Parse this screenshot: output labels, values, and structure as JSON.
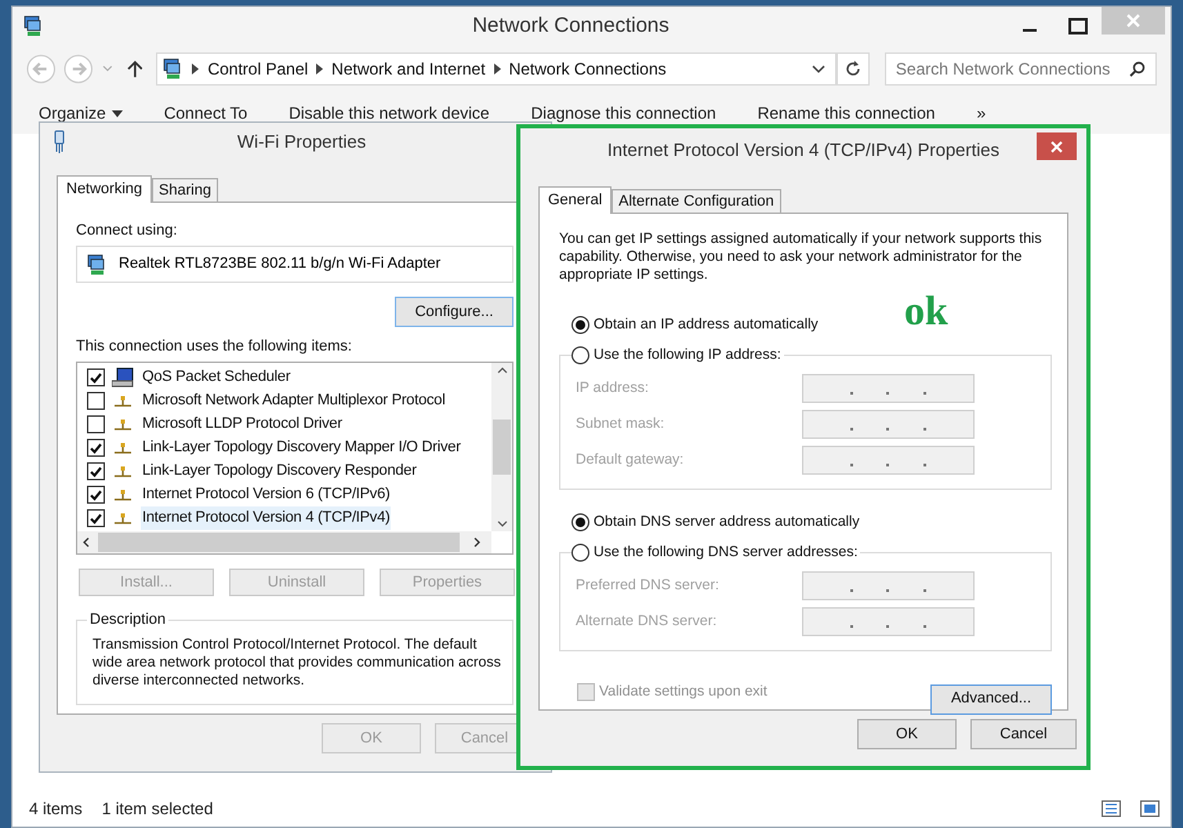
{
  "window": {
    "title": "Network Connections"
  },
  "address_bar": {
    "path": [
      "Control Panel",
      "Network and Internet",
      "Network Connections"
    ]
  },
  "search": {
    "placeholder": "Search Network Connections"
  },
  "toolbar": {
    "items": [
      {
        "label": "Organize",
        "kind": "menu"
      },
      {
        "label": "Connect To",
        "kind": "button"
      },
      {
        "label": "Disable this network device",
        "kind": "button"
      },
      {
        "label": "Diagnose this connection",
        "kind": "button"
      },
      {
        "label": "Rename this connection",
        "kind": "button"
      },
      {
        "label": "»",
        "kind": "button"
      }
    ]
  },
  "wifi_dialog": {
    "title": "Wi-Fi Properties",
    "tabs": [
      {
        "label": "Networking",
        "selected": true
      },
      {
        "label": "Sharing",
        "selected": false
      }
    ],
    "connect_using_label": "Connect using:",
    "adapter": "Realtek RTL8723BE 802.11 b/g/n Wi-Fi Adapter",
    "configure_button": "Configure...",
    "items_label": "This connection uses the following items:",
    "items": [
      {
        "label": "QoS Packet Scheduler",
        "kind": "service",
        "checked": true,
        "selected": false
      },
      {
        "label": "Microsoft Network Adapter Multiplexor Protocol",
        "kind": "protocol",
        "checked": false,
        "selected": false
      },
      {
        "label": "Microsoft LLDP Protocol Driver",
        "kind": "protocol",
        "checked": false,
        "selected": false
      },
      {
        "label": "Link-Layer Topology Discovery Mapper I/O Driver",
        "kind": "protocol",
        "checked": true,
        "selected": false
      },
      {
        "label": "Link-Layer Topology Discovery Responder",
        "kind": "protocol",
        "checked": true,
        "selected": false
      },
      {
        "label": "Internet Protocol Version 6 (TCP/IPv6)",
        "kind": "protocol",
        "checked": true,
        "selected": false
      },
      {
        "label": "Internet Protocol Version 4 (TCP/IPv4)",
        "kind": "protocol",
        "checked": true,
        "selected": true
      }
    ],
    "item_buttons": [
      {
        "label": "Install...",
        "disabled": true
      },
      {
        "label": "Uninstall",
        "disabled": true
      },
      {
        "label": "Properties",
        "disabled": true
      }
    ],
    "description": {
      "title": "Description",
      "text": "Transmission Control Protocol/Internet Protocol. The default wide area network protocol that provides communication across diverse interconnected networks."
    },
    "buttons": [
      {
        "label": "OK",
        "disabled": true
      },
      {
        "label": "Cancel",
        "disabled": true
      }
    ]
  },
  "tcp_dialog": {
    "title": "Internet Protocol Version 4 (TCP/IPv4) Properties",
    "tabs": [
      {
        "label": "General",
        "selected": true
      },
      {
        "label": "Alternate Configuration",
        "selected": false
      }
    ],
    "intro": "You can get IP settings assigned automatically if your network supports this capability. Otherwise, you need to ask your network administrator for the appropriate IP settings.",
    "ip_options": [
      {
        "label": "Obtain an IP address automatically",
        "selected": true
      },
      {
        "label": "Use the following IP address:",
        "selected": false
      }
    ],
    "ip_fields": [
      {
        "label": "IP address:",
        "disabled": true
      },
      {
        "label": "Subnet mask:",
        "disabled": true
      },
      {
        "label": "Default gateway:",
        "disabled": true
      }
    ],
    "dns_options": [
      {
        "label": "Obtain DNS server address automatically",
        "selected": true
      },
      {
        "label": "Use the following DNS server addresses:",
        "selected": false
      }
    ],
    "dns_fields": [
      {
        "label": "Preferred DNS server:",
        "disabled": true
      },
      {
        "label": "Alternate DNS server:",
        "disabled": true
      }
    ],
    "validate": {
      "label": "Validate settings upon exit",
      "checked": false,
      "disabled": true
    },
    "advanced_button": "Advanced...",
    "buttons": [
      {
        "label": "OK"
      },
      {
        "label": "Cancel"
      }
    ]
  },
  "annotation": {
    "text": "ok"
  },
  "status_bar": {
    "items": [
      "4 items",
      "1 item selected"
    ]
  }
}
